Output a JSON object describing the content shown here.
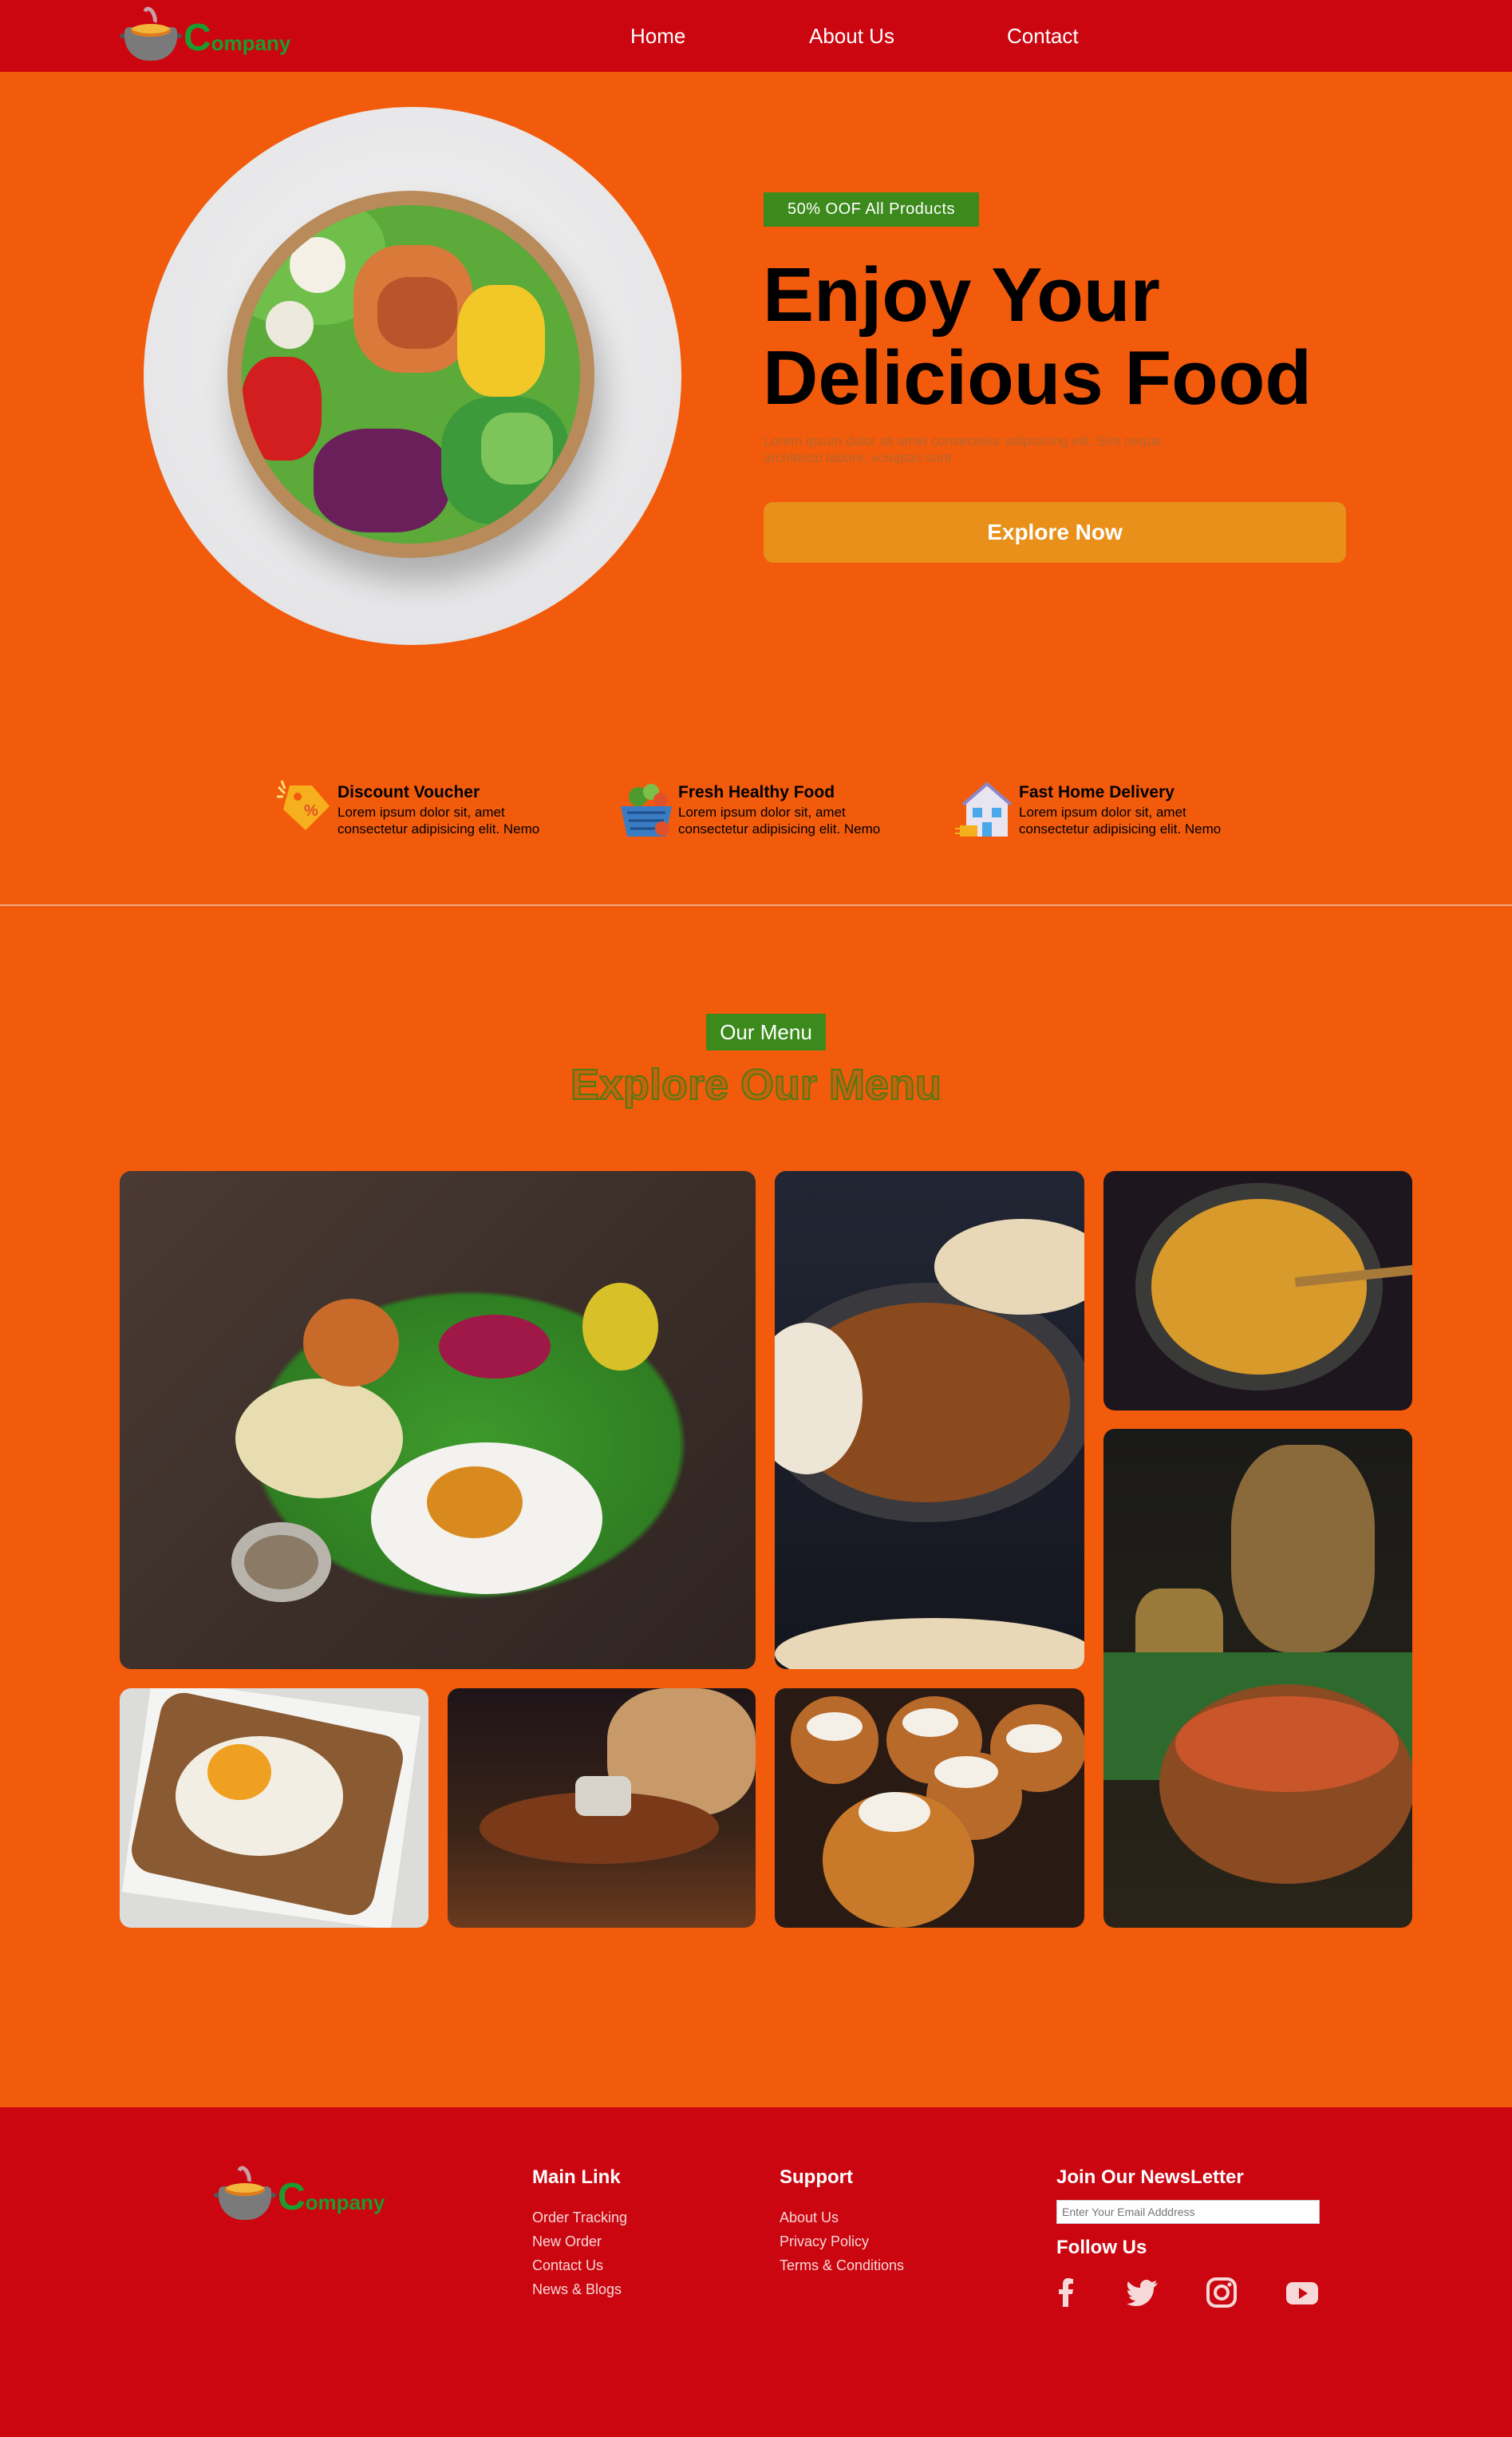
{
  "nav": {
    "brand_initial": "C",
    "brand_rest": "ompany",
    "links": [
      "Home",
      "About Us",
      "Contact"
    ]
  },
  "hero": {
    "badge": "50% OOF All Products",
    "title_line1": "Enjoy Your",
    "title_line2": "Delicious Food",
    "description": "Lorem ipsum dolor sit amet consectetur adipisicing elit. Sint neque architecto labore, voluptas sunt",
    "cta": "Explore Now"
  },
  "features": [
    {
      "title": "Discount Voucher",
      "text": "Lorem ipsum dolor sit, amet consectetur adipisicing elit. Nemo",
      "icon": "discount-tag-icon"
    },
    {
      "title": "Fresh Healthy Food",
      "text": "Lorem ipsum dolor sit, amet consectetur adipisicing elit. Nemo",
      "icon": "vegetable-basket-icon"
    },
    {
      "title": "Fast Home Delivery",
      "text": "Lorem ipsum dolor sit, amet consectetur adipisicing elit. Nemo",
      "icon": "delivery-house-icon"
    }
  ],
  "menu": {
    "badge": "Our Menu",
    "title": "Explore Our Menu",
    "images": [
      "banana-leaf-meal",
      "chicken-curry-pan",
      "roasted-potatoes",
      "copper-pot-curry",
      "egg-toast",
      "sizzler-plate",
      "cream-pastries"
    ]
  },
  "footer": {
    "brand_initial": "C",
    "brand_rest": "ompany",
    "main_link": {
      "title": "Main Link",
      "items": [
        "Order Tracking",
        "New Order",
        "Contact Us",
        "News & Blogs"
      ]
    },
    "support": {
      "title": "Support",
      "items": [
        "About Us",
        "Privacy Policy",
        "Terms & Conditions"
      ]
    },
    "newsletter": {
      "title": "Join Our NewsLetter",
      "placeholder": "Enter Your Email Adddress"
    },
    "follow": "Follow Us",
    "socials": [
      "facebook-icon",
      "twitter-icon",
      "instagram-icon",
      "youtube-icon"
    ]
  },
  "colors": {
    "nav_bg": "#CB0610",
    "page_bg": "#F25B0C",
    "badge_green": "#3C8A1C",
    "cta_orange": "#E8901A",
    "brand_green": "#1B9C2E"
  }
}
